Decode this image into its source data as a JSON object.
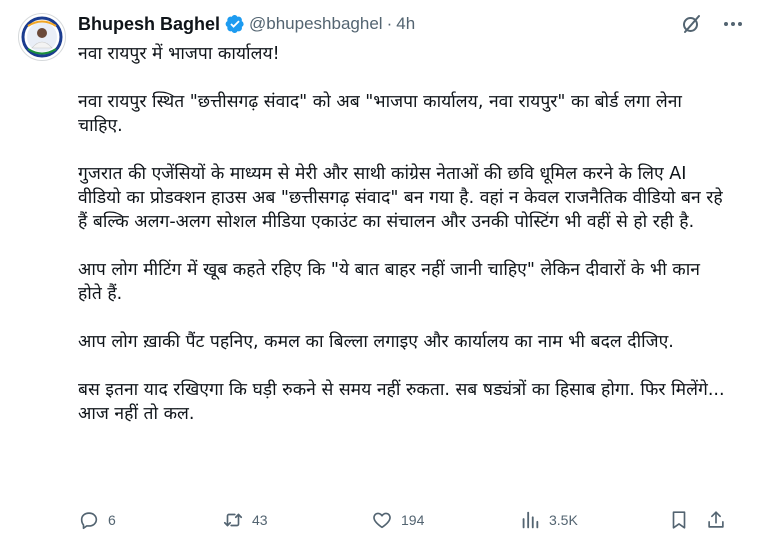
{
  "author": {
    "name": "Bhupesh Baghel",
    "handle": "@bhupeshbaghel",
    "separator": "·",
    "time": "4h",
    "avatar_icon": "profile-photo-icon",
    "verified_icon": "verified-badge-icon",
    "verified_color": "#1d9bf0"
  },
  "tweet": {
    "paragraphs": [
      "नवा रायपुर में भाजपा कार्यालय!",
      "नवा रायपुर स्थित \"छत्तीसगढ़ संवाद\" को अब \"भाजपा कार्यालय, नवा रायपुर\" का बोर्ड लगा लेना चाहिए.",
      "गुजरात की एजेंसियों के माध्यम से मेरी और साथी कांग्रेस नेताओं की छवि धूमिल करने के लिए AI वीडियो का प्रोडक्शन हाउस अब \"छत्तीसगढ़ संवाद\" बन गया है. वहां न केवल राजनैतिक वीडियो बन रहे हैं बल्कि अलग-अलग सोशल मीडिया एकाउंट का संचालन और उनकी पोस्टिंग भी वहीं से हो रही है.",
      "आप लोग मीटिंग में खूब कहते रहिए कि \"ये बात बाहर नहीं जानी चाहिए\" लेकिन दीवारों के भी कान होते हैं.",
      "आप लोग ख़ाकी पैंट पहनिए, कमल का बिल्ला लगाइए और कार्यालय का नाम भी बदल दीजिए.",
      "बस इतना याद रखिएगा कि घड़ी रुकने से समय नहीं रुकता. सब षड्यंत्रों का हिसाब होगा. फिर मिलेंगे... आज नहीं तो कल."
    ]
  },
  "top_actions": {
    "grok_icon": "grok-icon",
    "more_icon": "more-options-icon"
  },
  "actions": {
    "reply_count": "6",
    "retweet_count": "43",
    "like_count": "194",
    "views_count": "3.5K",
    "icon_color": "#536471"
  }
}
